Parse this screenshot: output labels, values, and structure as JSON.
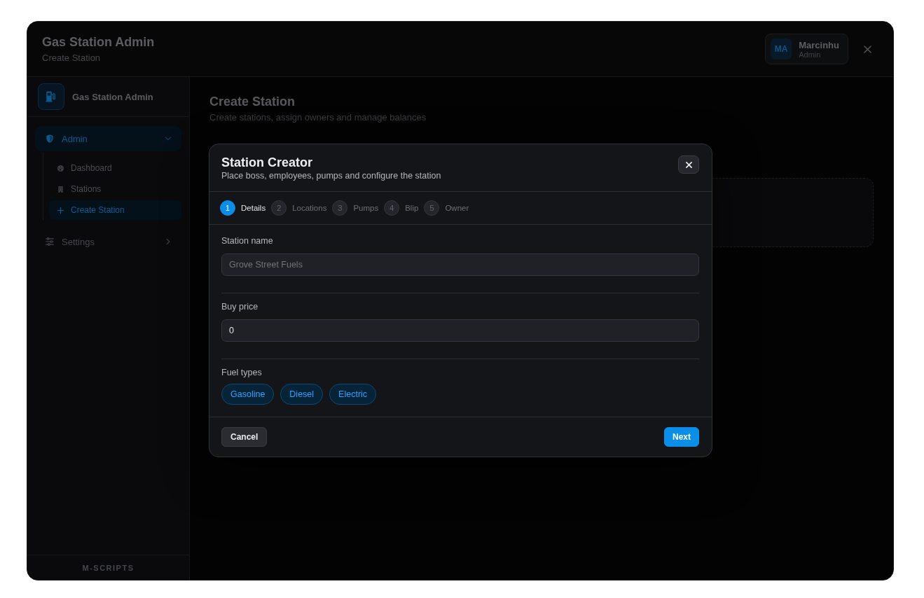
{
  "window": {
    "title": "Gas Station Admin",
    "subtitle": "Create Station"
  },
  "user": {
    "initials": "MA",
    "name": "Marcinhu",
    "role": "Admin"
  },
  "sidebar": {
    "brand": "Gas Station Admin",
    "items": [
      {
        "label": "Admin",
        "selected": true,
        "expanded": true,
        "children": [
          {
            "label": "Dashboard",
            "selected": false
          },
          {
            "label": "Stations",
            "selected": false
          },
          {
            "label": "Create Station",
            "selected": true
          }
        ]
      },
      {
        "label": "Settings",
        "selected": false,
        "expanded": false
      }
    ],
    "footer": "M-SCRIPTS"
  },
  "page": {
    "title": "Create Station",
    "subtitle": "Create stations, assign owners and manage balances"
  },
  "modal": {
    "title": "Station Creator",
    "subtitle": "Place boss, employees, pumps and configure the station",
    "steps": [
      {
        "number": "1",
        "label": "Details",
        "selected": true
      },
      {
        "number": "2",
        "label": "Locations",
        "selected": false
      },
      {
        "number": "3",
        "label": "Pumps",
        "selected": false
      },
      {
        "number": "4",
        "label": "Blip",
        "selected": false
      },
      {
        "number": "5",
        "label": "Owner",
        "selected": false
      }
    ],
    "fields": [
      {
        "kind": "input",
        "label": "Station name",
        "placeholder": "Grove Street Fuels"
      },
      {
        "kind": "input",
        "label": "Buy price",
        "value": "0"
      },
      {
        "kind": "chips",
        "label": "Fuel types",
        "options": [
          {
            "label": "Gasoline",
            "selected": true
          },
          {
            "label": "Diesel",
            "selected": true
          },
          {
            "label": "Electric",
            "selected": true
          }
        ]
      }
    ],
    "buttons": [
      {
        "label": "Cancel",
        "kind": "secondary"
      },
      {
        "label": "Next",
        "kind": "primary"
      }
    ]
  }
}
